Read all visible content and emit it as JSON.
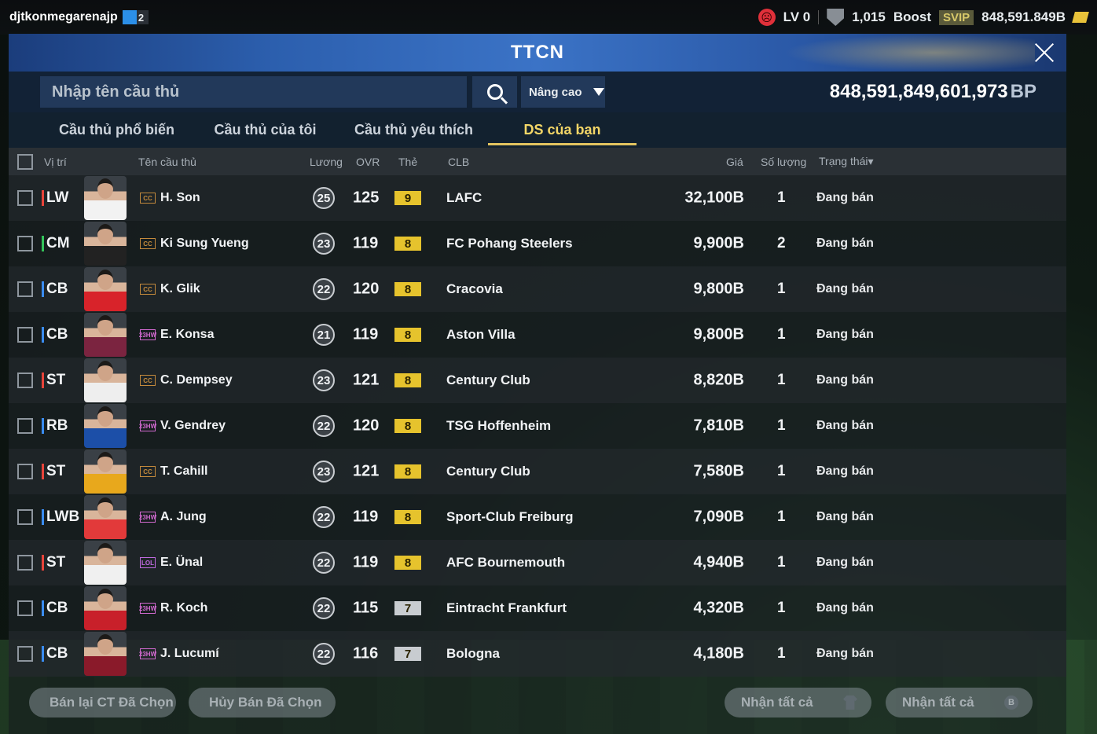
{
  "topbar": {
    "username": "djtkonmegarenajp",
    "level_badge": "2",
    "lv": "LV 0",
    "points": "1,015",
    "boost": "Boost",
    "svip": "SVIP",
    "balance": "848,591.849B"
  },
  "panel": {
    "title": "TTCN",
    "search_placeholder": "Nhập tên cầu thủ",
    "advanced_label": "Nâng cao",
    "bp_value": "848,591,849,601,973",
    "bp_unit": "BP"
  },
  "tabs": [
    {
      "label": "Cầu thủ phổ biến"
    },
    {
      "label": "Cầu thủ của tôi"
    },
    {
      "label": "Cầu thủ yêu thích"
    },
    {
      "label": "DS của bạn"
    }
  ],
  "columns": {
    "position": "Vị trí",
    "name": "Tên cầu thủ",
    "pay": "Lương",
    "ovr": "OVR",
    "card": "Thẻ",
    "club": "CLB",
    "price": "Giá",
    "qty": "Số lượng",
    "status": "Trạng thái▾"
  },
  "rows": [
    {
      "pos": "LW",
      "pos_color": "#e8433a",
      "tag": "CC",
      "tag_color": "#c48a3c",
      "name": "H. Son",
      "pay": "25",
      "ovr": "125",
      "lvl": "9",
      "lvl_bg": "#e6c32d",
      "club": "LAFC",
      "price": "32,100B",
      "qty": "1",
      "status": "Đang bán",
      "kit": "#f2f2f2"
    },
    {
      "pos": "CM",
      "pos_color": "#33c45a",
      "tag": "CC",
      "tag_color": "#c48a3c",
      "name": "Ki Sung Yueng",
      "pay": "23",
      "ovr": "119",
      "lvl": "8",
      "lvl_bg": "#e6c32d",
      "club": "FC Pohang Steelers",
      "price": "9,900B",
      "qty": "2",
      "status": "Đang bán",
      "kit": "#222"
    },
    {
      "pos": "CB",
      "pos_color": "#3a8cf0",
      "tag": "CC",
      "tag_color": "#c48a3c",
      "name": "K. Glik",
      "pay": "22",
      "ovr": "120",
      "lvl": "8",
      "lvl_bg": "#e6c32d",
      "club": "Cracovia",
      "price": "9,800B",
      "qty": "1",
      "status": "Đang bán",
      "kit": "#d8232a"
    },
    {
      "pos": "CB",
      "pos_color": "#3a8cf0",
      "tag": "23HW",
      "tag_color": "#d26ad0",
      "name": "E. Konsa",
      "pay": "21",
      "ovr": "119",
      "lvl": "8",
      "lvl_bg": "#e6c32d",
      "club": "Aston Villa",
      "price": "9,800B",
      "qty": "1",
      "status": "Đang bán",
      "kit": "#7b2440"
    },
    {
      "pos": "ST",
      "pos_color": "#e8433a",
      "tag": "CC",
      "tag_color": "#c48a3c",
      "name": "C. Dempsey",
      "pay": "23",
      "ovr": "121",
      "lvl": "8",
      "lvl_bg": "#e6c32d",
      "club": "Century Club",
      "price": "8,820B",
      "qty": "1",
      "status": "Đang bán",
      "kit": "#eeeeee"
    },
    {
      "pos": "RB",
      "pos_color": "#3a8cf0",
      "tag": "23HW",
      "tag_color": "#d26ad0",
      "name": "V. Gendrey",
      "pay": "22",
      "ovr": "120",
      "lvl": "8",
      "lvl_bg": "#e6c32d",
      "club": "TSG Hoffenheim",
      "price": "7,810B",
      "qty": "1",
      "status": "Đang bán",
      "kit": "#1c4fa8"
    },
    {
      "pos": "ST",
      "pos_color": "#e8433a",
      "tag": "CC",
      "tag_color": "#c48a3c",
      "name": "T. Cahill",
      "pay": "23",
      "ovr": "121",
      "lvl": "8",
      "lvl_bg": "#e6c32d",
      "club": "Century Club",
      "price": "7,580B",
      "qty": "1",
      "status": "Đang bán",
      "kit": "#e8a81c"
    },
    {
      "pos": "LWB",
      "pos_color": "#3a8cf0",
      "tag": "23HW",
      "tag_color": "#d26ad0",
      "name": "A. Jung",
      "pay": "22",
      "ovr": "119",
      "lvl": "8",
      "lvl_bg": "#e6c32d",
      "club": "Sport-Club Freiburg",
      "price": "7,090B",
      "qty": "1",
      "status": "Đang bán",
      "kit": "#e23a3a"
    },
    {
      "pos": "ST",
      "pos_color": "#e8433a",
      "tag": "LOL",
      "tag_color": "#c06ae0",
      "name": "E. Ünal",
      "pay": "22",
      "ovr": "119",
      "lvl": "8",
      "lvl_bg": "#e6c32d",
      "club": "AFC Bournemouth",
      "price": "4,940B",
      "qty": "1",
      "status": "Đang bán",
      "kit": "#f0f0f0"
    },
    {
      "pos": "CB",
      "pos_color": "#3a8cf0",
      "tag": "23HW",
      "tag_color": "#d26ad0",
      "name": "R. Koch",
      "pay": "22",
      "ovr": "115",
      "lvl": "7",
      "lvl_bg": "#c8ccd0",
      "club": "Eintracht Frankfurt",
      "price": "4,320B",
      "qty": "1",
      "status": "Đang bán",
      "kit": "#c8202a"
    },
    {
      "pos": "CB",
      "pos_color": "#3a8cf0",
      "tag": "23HW",
      "tag_color": "#d26ad0",
      "name": "J. Lucumí",
      "pay": "22",
      "ovr": "116",
      "lvl": "7",
      "lvl_bg": "#c8ccd0",
      "club": "Bologna",
      "price": "4,180B",
      "qty": "1",
      "status": "Đang bán",
      "kit": "#8a1a2a"
    }
  ],
  "buttons": {
    "resell": "Bán lại CT Đã Chọn",
    "cancel": "Hủy Bán Đã Chọn",
    "claim_all_players": "Nhận tất cả",
    "claim_all_bp": "Nhận tất cả",
    "bp_glyph": "B"
  },
  "colors": {
    "accent_gold": "#e2c35f",
    "header_blue": "#2c5fae"
  }
}
